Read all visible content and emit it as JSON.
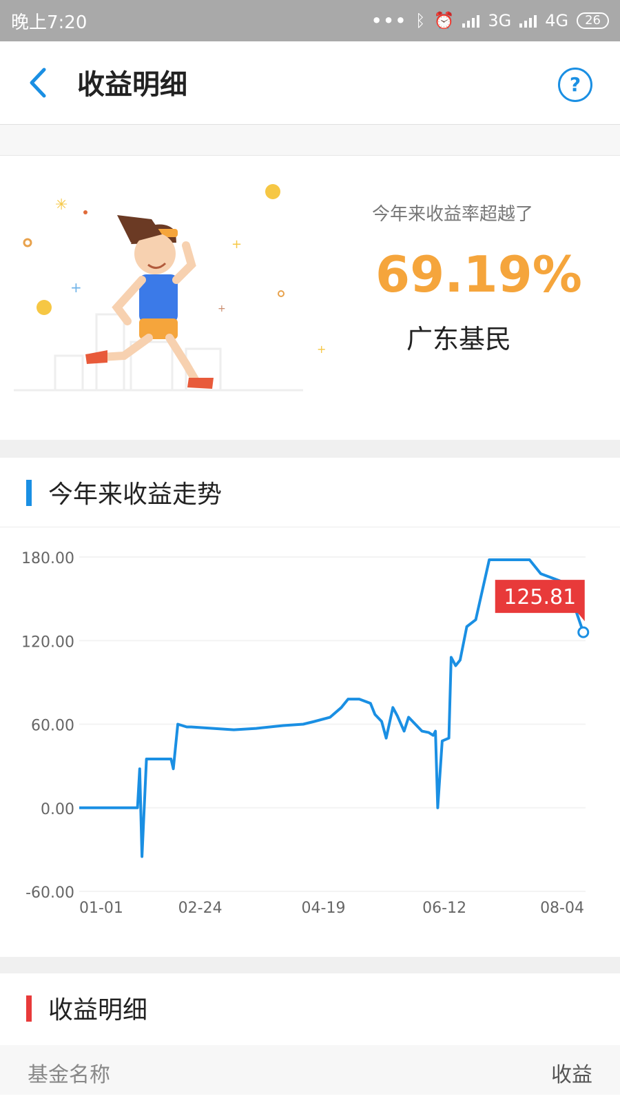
{
  "status_bar": {
    "time": "晚上7:20",
    "network1": "3G",
    "network2": "4G",
    "battery": "26",
    "icons": [
      "more-dots-icon",
      "bluetooth-icon",
      "alarm-icon",
      "signal-icon",
      "signal-icon",
      "battery-icon"
    ]
  },
  "header": {
    "title": "收益明细",
    "help_label": "?"
  },
  "hero": {
    "subtitle": "今年来收益率超越了",
    "rate": "69.19%",
    "group": "广东基民"
  },
  "trend": {
    "title": "今年来收益走势",
    "accent": "#1a8fe3",
    "tooltip": "125.81",
    "tooltip_color": "#e83a3a"
  },
  "chart_data": {
    "type": "line",
    "title": "",
    "xlabel": "",
    "ylabel": "",
    "ylim": [
      -60,
      180
    ],
    "yticks": [
      "180.00",
      "120.00",
      "60.00",
      "0.00",
      "-60.00"
    ],
    "xticks": [
      "01-01",
      "02-24",
      "04-19",
      "06-12",
      "08-04"
    ],
    "xlim": [
      "01-01",
      "08-14"
    ],
    "series": [
      {
        "color": "#1a8fe3",
        "points": [
          [
            "01-01",
            0
          ],
          [
            "01-27",
            0
          ],
          [
            "01-28",
            28
          ],
          [
            "01-29",
            -35
          ],
          [
            "01-31",
            35
          ],
          [
            "02-11",
            35
          ],
          [
            "02-12",
            28
          ],
          [
            "02-14",
            60
          ],
          [
            "02-18",
            58
          ],
          [
            "02-20",
            58
          ],
          [
            "03-10",
            56
          ],
          [
            "03-20",
            57
          ],
          [
            "04-01",
            59
          ],
          [
            "04-10",
            60
          ],
          [
            "04-15",
            62
          ],
          [
            "04-22",
            65
          ],
          [
            "04-27",
            72
          ],
          [
            "04-30",
            78
          ],
          [
            "05-05",
            78
          ],
          [
            "05-10",
            75
          ],
          [
            "05-12",
            67
          ],
          [
            "05-15",
            62
          ],
          [
            "05-17",
            50
          ],
          [
            "05-20",
            72
          ],
          [
            "05-22",
            66
          ],
          [
            "05-25",
            55
          ],
          [
            "05-27",
            65
          ],
          [
            "06-02",
            55
          ],
          [
            "06-05",
            54
          ],
          [
            "06-07",
            52
          ],
          [
            "06-08",
            55
          ],
          [
            "06-09",
            0
          ],
          [
            "06-11",
            48
          ],
          [
            "06-14",
            50
          ],
          [
            "06-15",
            108
          ],
          [
            "06-17",
            102
          ],
          [
            "06-19",
            106
          ],
          [
            "06-22",
            130
          ],
          [
            "06-26",
            135
          ],
          [
            "07-02",
            178
          ],
          [
            "07-07",
            178
          ],
          [
            "07-20",
            178
          ],
          [
            "07-25",
            168
          ],
          [
            "08-04",
            162
          ],
          [
            "08-07",
            160
          ],
          [
            "08-10",
            140
          ],
          [
            "08-13",
            126
          ]
        ],
        "last_value": 125.81
      }
    ],
    "grid": true,
    "legend": "none"
  },
  "detail": {
    "title": "收益明细",
    "accent": "#e83a3a",
    "columns": [
      "基金名称",
      "收益"
    ]
  }
}
